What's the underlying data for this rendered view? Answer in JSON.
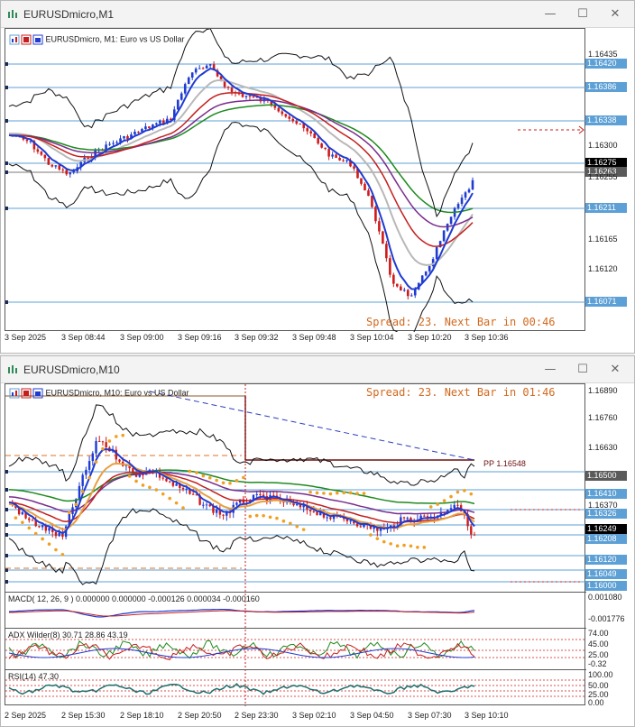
{
  "window1": {
    "title": "EURUSDmicro,M1",
    "symbol_label": "EURUSDmicro, M1:  Euro vs US Dollar",
    "spread_text": "Spread: 23. Next Bar in 00:46",
    "price_labels": [
      "1.16435",
      "1.16390",
      "1.16345",
      "1.16300",
      "1.16255",
      "1.16210",
      "1.16165",
      "1.16120",
      "1.16075"
    ],
    "tags": [
      "1.16420",
      "1.16386",
      "1.16338",
      "1.16275",
      "1.16263",
      "1.16211",
      "1.16071"
    ],
    "time_labels": [
      "3 Sep 2025",
      "3 Sep 08:44",
      "3 Sep 09:00",
      "3 Sep 09:16",
      "3 Sep 09:32",
      "3 Sep 09:48",
      "3 Sep 10:04",
      "3 Sep 10:20",
      "3 Sep 10:36"
    ]
  },
  "window2": {
    "title": "EURUSDmicro,M10",
    "symbol_label": "EURUSDmicro, M10:  Euro vs US Dollar",
    "spread_text": "Spread: 23. Next Bar in 01:46",
    "pp_label": "PP 1.16548",
    "price_labels": [
      "1.16890",
      "1.16760",
      "1.16630",
      "1.16500",
      "1.16370",
      "1.16240",
      "1.16120"
    ],
    "tags": [
      "1.16500",
      "1.16410",
      "1.16326",
      "1.16249",
      "1.16208",
      "1.16120",
      "1.16049",
      "1.16000"
    ],
    "macd_label": "MACD( 12, 26, 9 ) 0.000000 0.000000 -0.000126 0.000034 -0.000160",
    "macd_scale": [
      "0.001080",
      "-0.001776"
    ],
    "adx_label": "ADX Wilder(8) 30.71 28.86 43.19",
    "adx_scale": [
      "74.00",
      "45.00",
      "25.00",
      "-0.32"
    ],
    "rsi_label": "RSI(14) 47.30",
    "rsi_scale": [
      "100.00",
      "50.00",
      "25.00",
      "0.00"
    ],
    "time_labels": [
      "2 Sep 2025",
      "2 Sep 15:30",
      "2 Sep 18:10",
      "2 Sep 20:50",
      "2 Sep 23:30",
      "3 Sep 02:10",
      "3 Sep 04:50",
      "3 Sep 07:30",
      "3 Sep 10:10"
    ]
  },
  "controls": {
    "minimize": "—",
    "maximize": "☐",
    "close": "✕"
  },
  "colors": {
    "bull": "#1f3bd1",
    "bear": "#d01a1a",
    "hline": "#5da0d6",
    "ma_green": "#1e8a1e",
    "ma_purple": "#7a2c8c",
    "ma_red": "#c41e1e",
    "sar": "#f0a020"
  }
}
